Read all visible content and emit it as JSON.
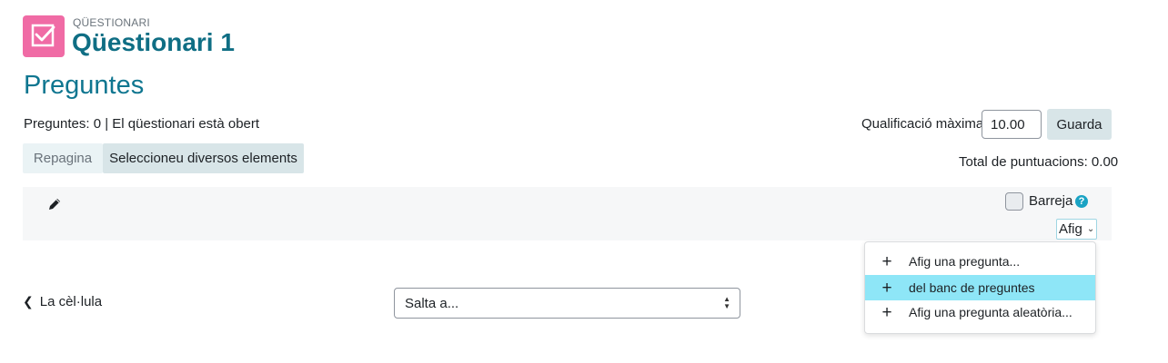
{
  "header": {
    "activity_type": "QÜESTIONARI",
    "activity_title": "Qüestionari 1",
    "icon": "checkbox-icon",
    "icon_color": "#f06ba5"
  },
  "section_title": "Preguntes",
  "summary": "Preguntes: 0 | El qüestionari està obert",
  "grade": {
    "label": "Qualificació màxima",
    "value": "10.00",
    "save_label": "Guarda"
  },
  "toolbar": {
    "repaginate_label": "Repagina",
    "select_multiple_label": "Seleccioneu diversos elements"
  },
  "total_marks": "Total de puntuacions: 0.00",
  "section": {
    "edit_icon": "pencil-icon",
    "shuffle_label": "Barreja",
    "help_symbol": "?",
    "add_label": "Afig"
  },
  "add_menu": {
    "items": [
      {
        "label": "Afig una pregunta...",
        "icon": "plus-icon"
      },
      {
        "label": "del banc de preguntes",
        "icon": "plus-icon"
      },
      {
        "label": "Afig una pregunta aleatòria...",
        "icon": "plus-icon"
      }
    ],
    "highlight_color": "#8ee6f7"
  },
  "footer": {
    "prev_link": "La cèl·lula",
    "jump_select": "Salta a..."
  },
  "colors": {
    "title": "#0f6e84",
    "button_bg": "#d8e5e8"
  }
}
